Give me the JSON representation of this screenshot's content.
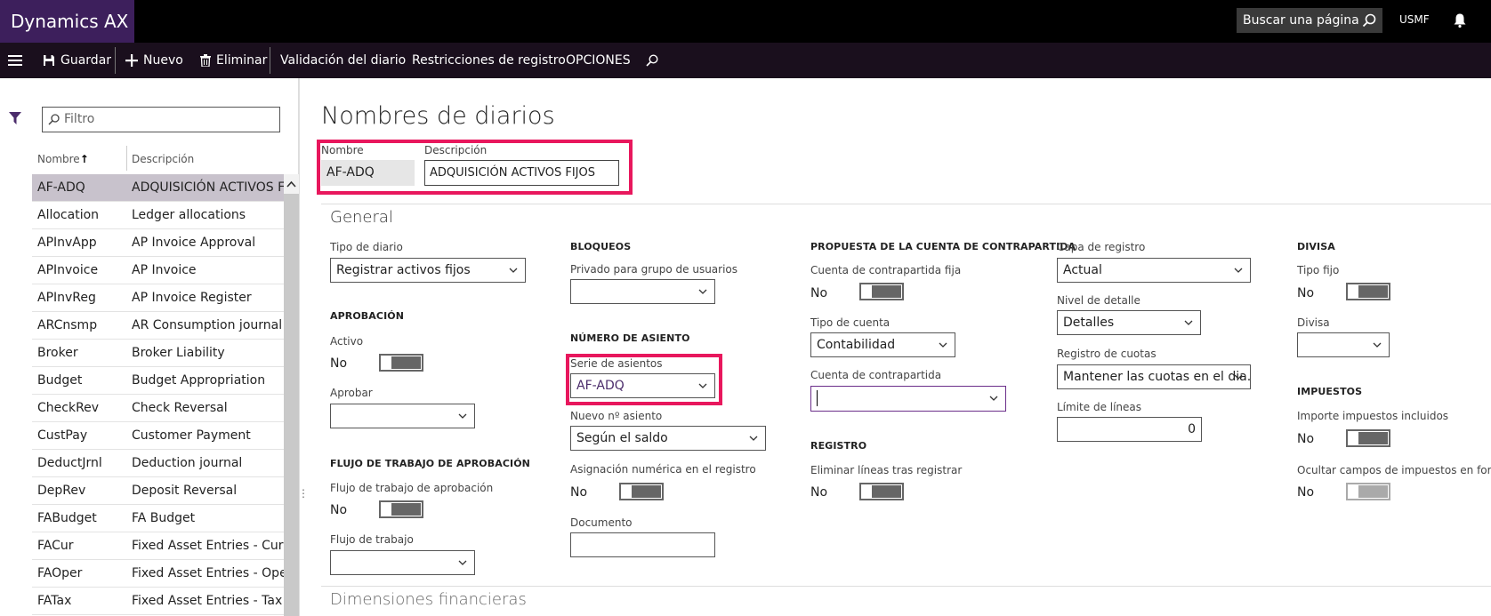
{
  "app": {
    "title": "Dynamics AX",
    "search_placeholder": "Buscar una página",
    "company": "USMF"
  },
  "toolbar": {
    "save": "Guardar",
    "new": "Nuevo",
    "delete": "Eliminar",
    "validate": "Validación del diario",
    "restrictions": "Restricciones de registro",
    "options": "OPCIONES"
  },
  "list": {
    "filter_placeholder": "Filtro",
    "col_name": "Nombre",
    "col_desc": "Descripción",
    "rows": [
      {
        "name": "AF-ADQ",
        "desc": "ADQUISICIÓN ACTIVOS FIJOS"
      },
      {
        "name": "Allocation",
        "desc": "Ledger allocations"
      },
      {
        "name": "APInvApp",
        "desc": "AP Invoice Approval"
      },
      {
        "name": "APInvoice",
        "desc": "AP Invoice"
      },
      {
        "name": "APInvReg",
        "desc": "AP Invoice Register"
      },
      {
        "name": "ARCnsmp",
        "desc": "AR Consumption journal"
      },
      {
        "name": "Broker",
        "desc": "Broker Liability"
      },
      {
        "name": "Budget",
        "desc": "Budget Appropriation"
      },
      {
        "name": "CheckRev",
        "desc": "Check Reversal"
      },
      {
        "name": "CustPay",
        "desc": "Customer Payment"
      },
      {
        "name": "DeductJrnl",
        "desc": "Deduction journal"
      },
      {
        "name": "DepRev",
        "desc": "Deposit Reversal"
      },
      {
        "name": "FABudget",
        "desc": "FA Budget"
      },
      {
        "name": "FACur",
        "desc": "Fixed Asset Entries - Current"
      },
      {
        "name": "FAOper",
        "desc": "Fixed Asset Entries - Operations"
      },
      {
        "name": "FATax",
        "desc": "Fixed Asset Entries - Tax"
      }
    ]
  },
  "header": {
    "title": "Nombres de diarios",
    "name_label": "Nombre",
    "name_value": "AF-ADQ",
    "desc_label": "Descripción",
    "desc_value": "ADQUISICIÓN ACTIVOS FIJOS"
  },
  "general": {
    "title": "General",
    "tipo_diario_label": "Tipo de diario",
    "tipo_diario_value": "Registrar activos fijos",
    "aprobacion_title": "APROBACIÓN",
    "activo_label": "Activo",
    "activo_value": "No",
    "aprobar_label": "Aprobar",
    "flujo_title": "FLUJO DE TRABAJO DE APROBACIÓN",
    "flujo_aprob_label": "Flujo de trabajo de aprobación",
    "flujo_aprob_value": "No",
    "flujo_label": "Flujo de trabajo",
    "bloqueos_title": "BLOQUEOS",
    "privado_label": "Privado para grupo de usuarios",
    "num_asiento_title": "NÚMERO DE ASIENTO",
    "serie_label": "Serie de asientos",
    "serie_value": "AF-ADQ",
    "nuevo_label": "Nuevo nº asiento",
    "nuevo_value": "Según el saldo",
    "asignacion_label": "Asignación numérica en el registro",
    "asignacion_value": "No",
    "documento_label": "Documento",
    "propuesta_title": "PROPUESTA DE LA CUENTA DE CONTRAPARTIDA",
    "fija_label": "Cuenta de contrapartida fija",
    "fija_value": "No",
    "tipo_cuenta_label": "Tipo de cuenta",
    "tipo_cuenta_value": "Contabilidad",
    "contra_label": "Cuenta de contrapartida",
    "registro_title": "REGISTRO",
    "eliminar_label": "Eliminar líneas tras registrar",
    "eliminar_value": "No",
    "capa_label": "Capa de registro",
    "capa_value": "Actual",
    "nivel_label": "Nivel de detalle",
    "nivel_value": "Detalles",
    "cuotas_label": "Registro de cuotas",
    "cuotas_value": "Mantener las cuotas en el dia...",
    "limite_label": "Límite de líneas",
    "limite_value": "0",
    "divisa_title": "DIVISA",
    "tipo_fijo_label": "Tipo fijo",
    "tipo_fijo_value": "No",
    "divisa_label": "Divisa",
    "impuestos_title": "IMPUESTOS",
    "importe_label": "Importe impuestos incluidos",
    "importe_value": "No",
    "ocultar_label": "Ocultar campos de impuestos en for...",
    "ocultar_value": "No"
  },
  "dims": {
    "title": "Dimensiones financieras"
  },
  "colors": {
    "brand": "#3d1f5c",
    "highlight": "#e8175d",
    "selected_row": "#c8c2cc"
  }
}
